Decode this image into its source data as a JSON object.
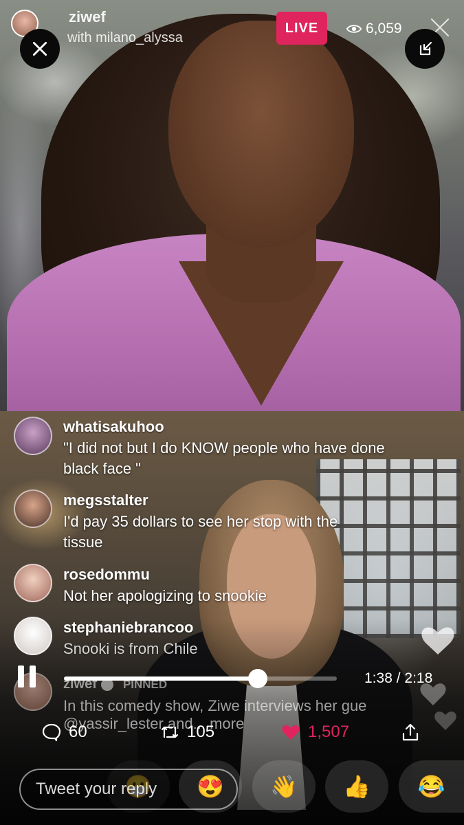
{
  "broadcast": {
    "host": "ziwef",
    "guest_line": "with milano_alyssa",
    "live_label": "LIVE",
    "viewer_count": "6,059"
  },
  "comments": [
    {
      "user": "whatisakuhoo",
      "text": "\"I did not but I do KNOW people who have done black face \""
    },
    {
      "user": "megsstalter",
      "text": "I'd pay 35 dollars to see her stop with the tissue"
    },
    {
      "user": "rosedommu",
      "text": "Not her apologizing to snookie"
    },
    {
      "user": "stephaniebrancoo",
      "text": "Snooki is from Chile"
    }
  ],
  "pinned": {
    "user": "ziwef",
    "tag": "PINNED",
    "text_line1": "In this comedy show, Ziwe interviews her gue",
    "text_line2": "@yassir_lester and... more"
  },
  "player": {
    "elapsed": "1:38",
    "separator": "/",
    "duration": "2:18",
    "progress_fraction": 0.71
  },
  "actions": {
    "replies": "60",
    "retweets": "105",
    "likes": "1,507"
  },
  "reply": {
    "placeholder": "Tweet your reply",
    "emojis": [
      "😷",
      "😍",
      "👋",
      "👍",
      "😂"
    ]
  },
  "colors": {
    "live": "#e0245e",
    "like": "#e0245e"
  }
}
